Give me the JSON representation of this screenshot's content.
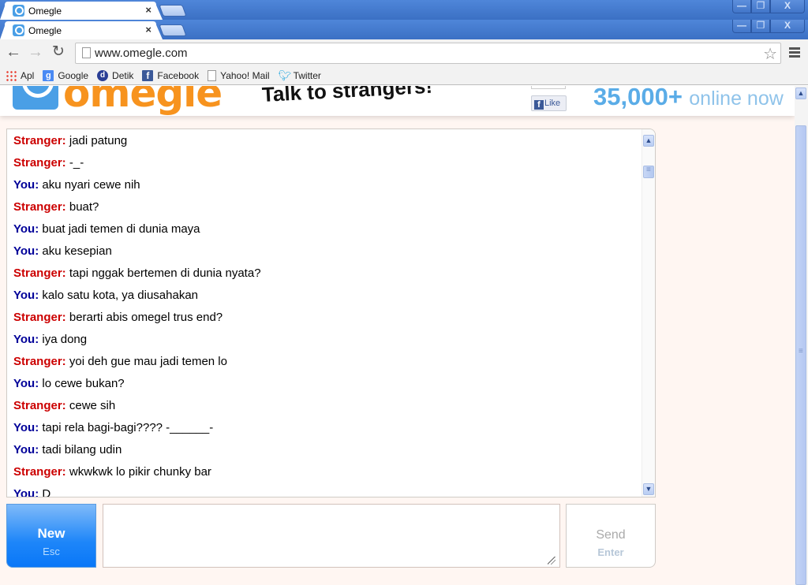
{
  "browser": {
    "windows": [
      {
        "tab_title": "Omegle",
        "close_glyph": "×"
      },
      {
        "tab_title": "Omegle",
        "close_glyph": "×"
      }
    ],
    "window_controls": {
      "minimize": "—",
      "restore": "❐",
      "close": "X"
    },
    "nav": {
      "back": "←",
      "forward": "→",
      "reload": "↻"
    },
    "url": "www.omegle.com",
    "bookmark_star": "☆",
    "bookmarks": [
      {
        "label": "Apl",
        "icon": "apps-icon"
      },
      {
        "label": "Google",
        "icon": "google-icon"
      },
      {
        "label": "Detik",
        "icon": "detik-icon"
      },
      {
        "label": "Facebook",
        "icon": "facebook-icon"
      },
      {
        "label": "Yahoo! Mail",
        "icon": "page-icon"
      },
      {
        "label": "Twitter",
        "icon": "twitter-icon"
      }
    ]
  },
  "header": {
    "logo_text": "omegle",
    "tagline": "Talk to strangers!",
    "fb_like": {
      "f": "f",
      "label": "Like"
    },
    "online_count": "35,000+",
    "online_label": "online now"
  },
  "chat": {
    "log": [
      {
        "who": "Stranger:",
        "role": "stranger",
        "text": "jadi patung"
      },
      {
        "who": "Stranger:",
        "role": "stranger",
        "text": "-_-"
      },
      {
        "who": "You:",
        "role": "you",
        "text": "aku nyari cewe nih"
      },
      {
        "who": "Stranger:",
        "role": "stranger",
        "text": "buat?"
      },
      {
        "who": "You:",
        "role": "you",
        "text": "buat jadi temen di dunia maya"
      },
      {
        "who": "You:",
        "role": "you",
        "text": "aku kesepian"
      },
      {
        "who": "Stranger:",
        "role": "stranger",
        "text": "tapi nggak bertemen di dunia nyata?"
      },
      {
        "who": "You:",
        "role": "you",
        "text": "kalo satu kota, ya diusahakan"
      },
      {
        "who": "Stranger:",
        "role": "stranger",
        "text": "berarti abis omegel trus end?"
      },
      {
        "who": "You:",
        "role": "you",
        "text": "iya dong"
      },
      {
        "who": "Stranger:",
        "role": "stranger",
        "text": "yoi deh gue mau jadi temen lo"
      },
      {
        "who": "You:",
        "role": "you",
        "text": "lo cewe bukan?"
      },
      {
        "who": "Stranger:",
        "role": "stranger",
        "text": "cewe sih"
      },
      {
        "who": "You:",
        "role": "you",
        "text": "tapi rela bagi-bagi???? -______-"
      },
      {
        "who": "You:",
        "role": "you",
        "text": "tadi bilang udin"
      },
      {
        "who": "Stranger:",
        "role": "stranger",
        "text": "wkwkwk lo pikir chunky bar"
      },
      {
        "who": "You:",
        "role": "you",
        "text": "D"
      }
    ],
    "colors": {
      "stranger": "#cc0000",
      "you": "#000099"
    },
    "scroll_up": "▲",
    "scroll_down": "▼"
  },
  "controls": {
    "new_button": {
      "label": "New",
      "shortcut": "Esc"
    },
    "message_input": {
      "value": "",
      "placeholder": ""
    },
    "send_button": {
      "label": "Send",
      "shortcut": "Enter"
    }
  },
  "page_scroll": {
    "up": "▲"
  }
}
